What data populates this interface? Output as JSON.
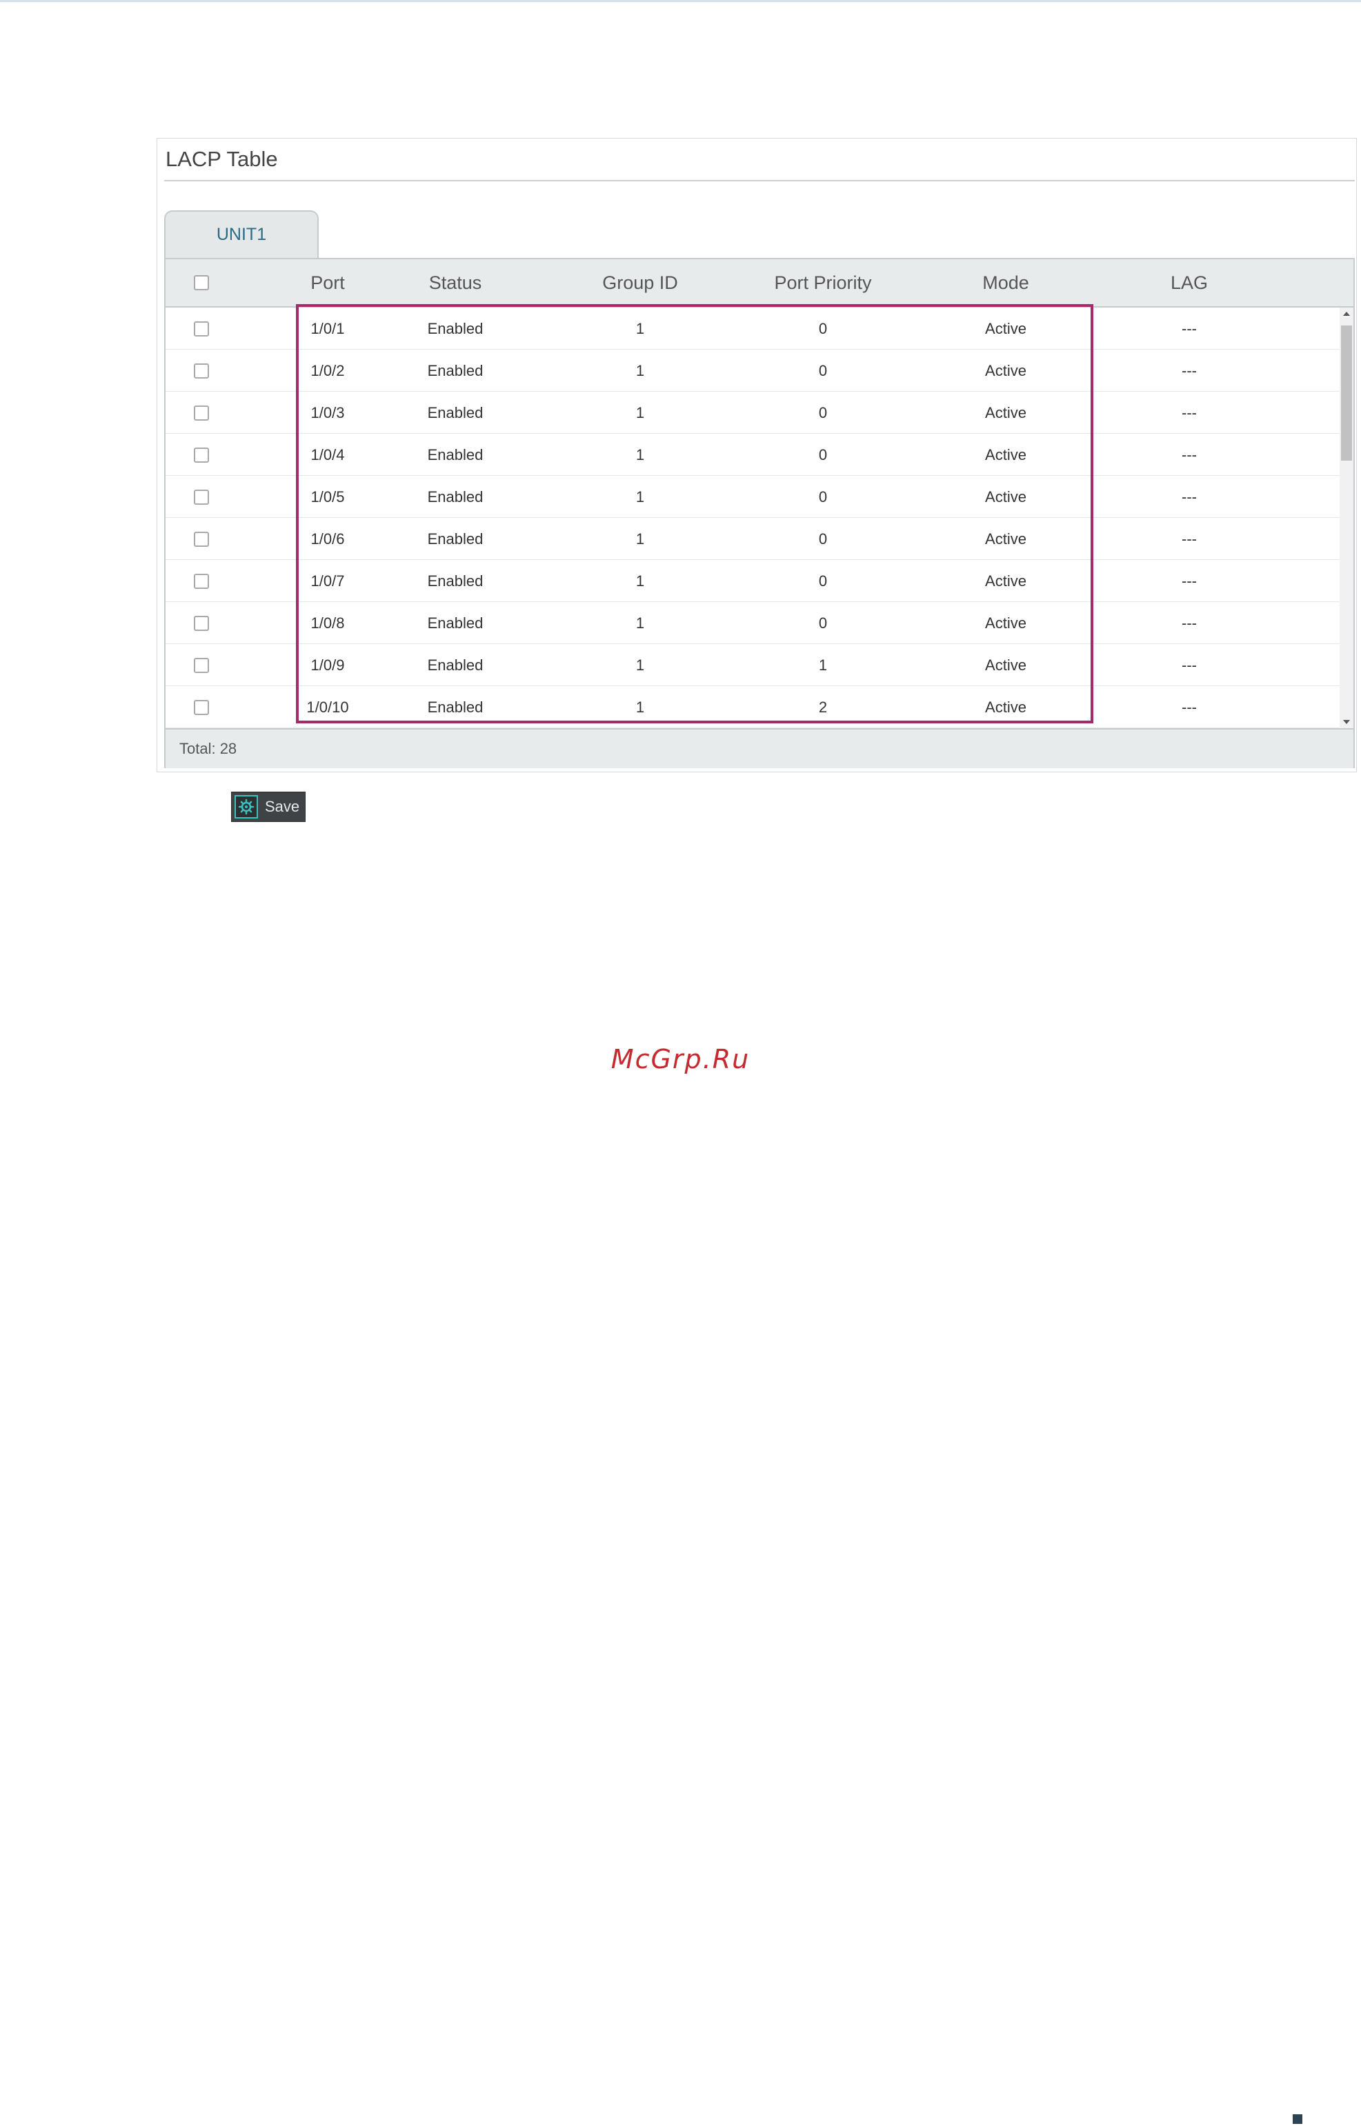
{
  "panel": {
    "title": "LACP Table",
    "tabs": [
      {
        "label": "UNIT1",
        "active": true
      }
    ]
  },
  "table": {
    "columns": [
      "Port",
      "Status",
      "Group ID",
      "Port Priority",
      "Mode",
      "LAG"
    ],
    "rows": [
      {
        "port": "1/0/1",
        "status": "Enabled",
        "group_id": "1",
        "port_priority": "0",
        "mode": "Active",
        "lag": "---"
      },
      {
        "port": "1/0/2",
        "status": "Enabled",
        "group_id": "1",
        "port_priority": "0",
        "mode": "Active",
        "lag": "---"
      },
      {
        "port": "1/0/3",
        "status": "Enabled",
        "group_id": "1",
        "port_priority": "0",
        "mode": "Active",
        "lag": "---"
      },
      {
        "port": "1/0/4",
        "status": "Enabled",
        "group_id": "1",
        "port_priority": "0",
        "mode": "Active",
        "lag": "---"
      },
      {
        "port": "1/0/5",
        "status": "Enabled",
        "group_id": "1",
        "port_priority": "0",
        "mode": "Active",
        "lag": "---"
      },
      {
        "port": "1/0/6",
        "status": "Enabled",
        "group_id": "1",
        "port_priority": "0",
        "mode": "Active",
        "lag": "---"
      },
      {
        "port": "1/0/7",
        "status": "Enabled",
        "group_id": "1",
        "port_priority": "0",
        "mode": "Active",
        "lag": "---"
      },
      {
        "port": "1/0/8",
        "status": "Enabled",
        "group_id": "1",
        "port_priority": "0",
        "mode": "Active",
        "lag": "---"
      },
      {
        "port": "1/0/9",
        "status": "Enabled",
        "group_id": "1",
        "port_priority": "1",
        "mode": "Active",
        "lag": "---"
      },
      {
        "port": "1/0/10",
        "status": "Enabled",
        "group_id": "1",
        "port_priority": "2",
        "mode": "Active",
        "lag": "---"
      }
    ],
    "footer_total": "Total: 28"
  },
  "toolbar": {
    "save_label": "Save",
    "save_icon": "save-gear-icon"
  },
  "watermark": "McGrp.Ru",
  "colors": {
    "highlight_border": "#a8286b",
    "tab_text": "#2b6b86",
    "save_icon_accent": "#3bc2c0",
    "watermark": "#c42a30"
  }
}
